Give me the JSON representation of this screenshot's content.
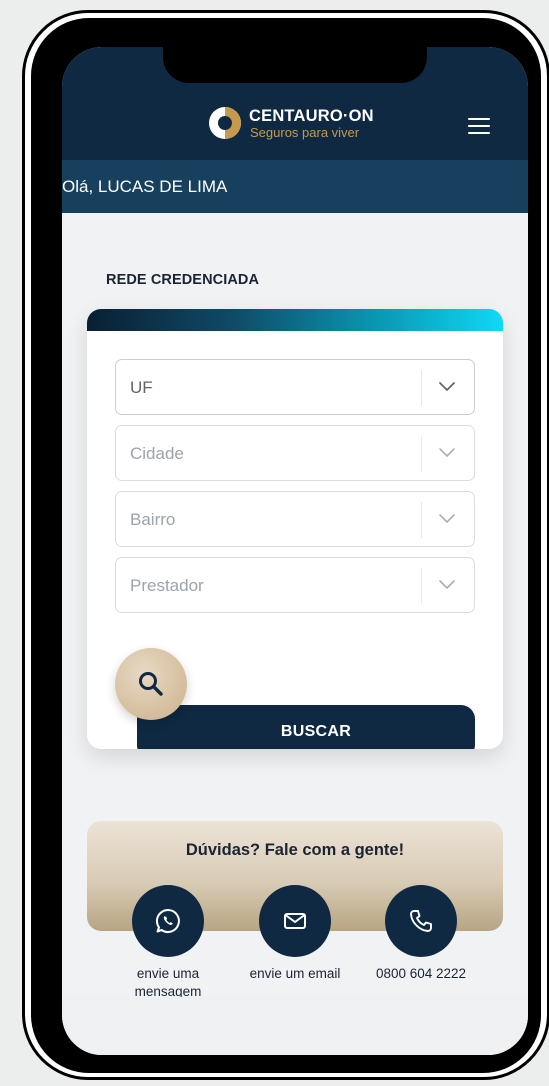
{
  "header": {
    "brand_name": "CENTAURO·ON",
    "brand_tagline": "Seguros para viver",
    "menu_icon": "hamburger-menu-icon",
    "colors": {
      "primary": "#0f2942",
      "accent_gold": "#c69a4c",
      "greeting_bar": "#17405e"
    }
  },
  "greeting": {
    "text": "Olá, LUCAS DE LIMA"
  },
  "rede": {
    "title": "REDE CREDENCIADA",
    "fields": [
      {
        "label": "UF",
        "state": "active"
      },
      {
        "label": "Cidade",
        "state": "disabled"
      },
      {
        "label": "Bairro",
        "state": "disabled"
      },
      {
        "label": "Prestador",
        "state": "disabled"
      }
    ],
    "search_icon": "magnifier-icon",
    "button_label": "BUSCAR"
  },
  "contact": {
    "title": "Dúvidas? Fale com a gente!",
    "items": [
      {
        "icon": "whatsapp-icon",
        "label": "envie uma mensagem"
      },
      {
        "icon": "email-icon",
        "label": "envie um email"
      },
      {
        "icon": "phone-icon",
        "label": "0800 604 2222"
      }
    ]
  }
}
